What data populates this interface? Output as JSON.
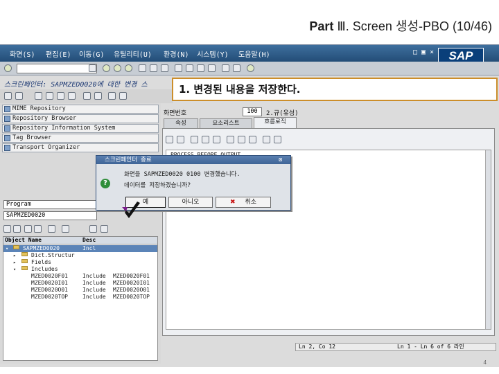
{
  "slide": {
    "title_part": "Part",
    "title_rest": "Ⅲ. Screen 생성-PBO (10/46)",
    "page_number": "4"
  },
  "menubar": {
    "items": [
      "화면(S)",
      "편집(E)",
      "이동(G)",
      "유틸리티(U)",
      "환경(N)",
      "시스템(Y)",
      "도움말(H)"
    ],
    "window_controls": "□ ▣ ×",
    "logo": "SAP"
  },
  "screen_title": "스크린페인터: SAPMZED0020에 대한 변경 스",
  "callout": {
    "text": "1. 변경된 내용을 저장한다."
  },
  "navigator": {
    "items": [
      "MIME Repository",
      "Repository Browser",
      "Repository Information System",
      "Tag Browser",
      "Transport Organizer"
    ],
    "object_type": "Program",
    "object_name": "SAPMZED0020",
    "tree_headers": [
      "Object Name",
      "Desc"
    ],
    "tree_rows": [
      {
        "name": "SAPMZED0020",
        "desc": "Incl",
        "type": "program"
      },
      {
        "name": "Dict.Structur",
        "desc": "",
        "type": "folder"
      },
      {
        "name": "Fields",
        "desc": "",
        "type": "folder"
      },
      {
        "name": "Includes",
        "desc": "",
        "type": "folder"
      },
      {
        "name": "MZED0020F01",
        "desc": "Include",
        "extra": "MZED0020F01",
        "type": "item"
      },
      {
        "name": "MZED0020I01",
        "desc": "Include",
        "extra": "MZED0020I01",
        "type": "item"
      },
      {
        "name": "MZED0020O01",
        "desc": "Include",
        "extra": "MZED0020O01",
        "type": "item"
      },
      {
        "name": "MZED0020TOP",
        "desc": "Include",
        "extra": "MZED0020TOP",
        "type": "item"
      }
    ]
  },
  "screen_painter": {
    "screen_label": "화면번호",
    "screen_number": "100",
    "screen_status": "2.규(유성)",
    "tabs": [
      "속성",
      "요소리스트",
      "흐름로직"
    ],
    "active_tab": 2,
    "code_lines": [
      "PROCESS BEFORE OUTPUT."
    ]
  },
  "status_bar": {
    "cursor": "Ln  2, Co 12",
    "range": "Ln  1 - Ln  6 of  6 라인"
  },
  "dialog": {
    "title": "스크린페인터 종료",
    "message_line1": "화면을 SAPMZED0020 0100 변경했습니다.",
    "message_line2": "데이터를 저장하겠습니까?",
    "yes_label": "예",
    "no_label": "아니오",
    "cancel_label": "취소"
  },
  "colors": {
    "menubar": "#234d77",
    "callout_border": "#cc8e2a",
    "selection": "#5b84b8"
  }
}
